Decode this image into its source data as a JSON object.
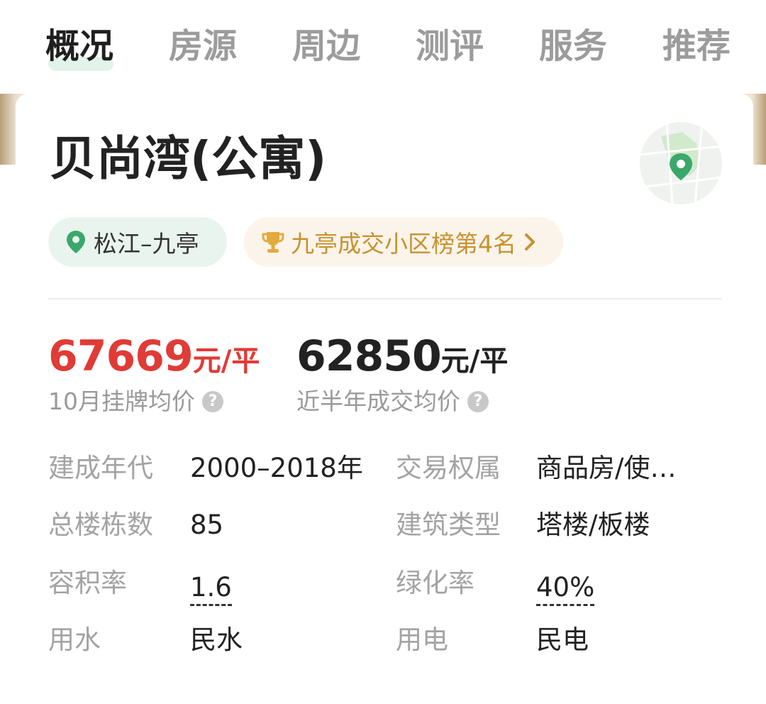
{
  "tabs": [
    "概况",
    "房源",
    "周边",
    "测评",
    "服务",
    "推荐"
  ],
  "community": {
    "name": "贝尚湾(公寓)",
    "location_chip": "松江–九亭",
    "rank_chip": "九亭成交小区榜第4名"
  },
  "prices": {
    "listing": {
      "value": "67669",
      "unit": "元/平",
      "label": "10月挂牌均价",
      "color": "#e03b36"
    },
    "deal": {
      "value": "62850",
      "unit": "元/平",
      "label": "近半年成交均价",
      "color": "#222222"
    }
  },
  "info": [
    {
      "key": "建成年代",
      "value": "2000–2018年"
    },
    {
      "key": "交易权属",
      "value": "商品房/使…"
    },
    {
      "key": "总楼栋数",
      "value": "85"
    },
    {
      "key": "建筑类型",
      "value": "塔楼/板楼"
    },
    {
      "key": "容积率",
      "value": "1.6"
    },
    {
      "key": "绿化率",
      "value": "40%"
    },
    {
      "key": "用水",
      "value": "民水"
    },
    {
      "key": "用电",
      "value": "民电"
    }
  ],
  "icons": {
    "location": "map-pin-icon",
    "trophy": "trophy-icon",
    "chevron": "chevron-right-icon",
    "help": "question-circle-icon",
    "map": "map-thumbnail-icon"
  },
  "colors": {
    "accent_green": "#3aa86b",
    "gold": "#c7922f",
    "price_red": "#e03b36"
  }
}
